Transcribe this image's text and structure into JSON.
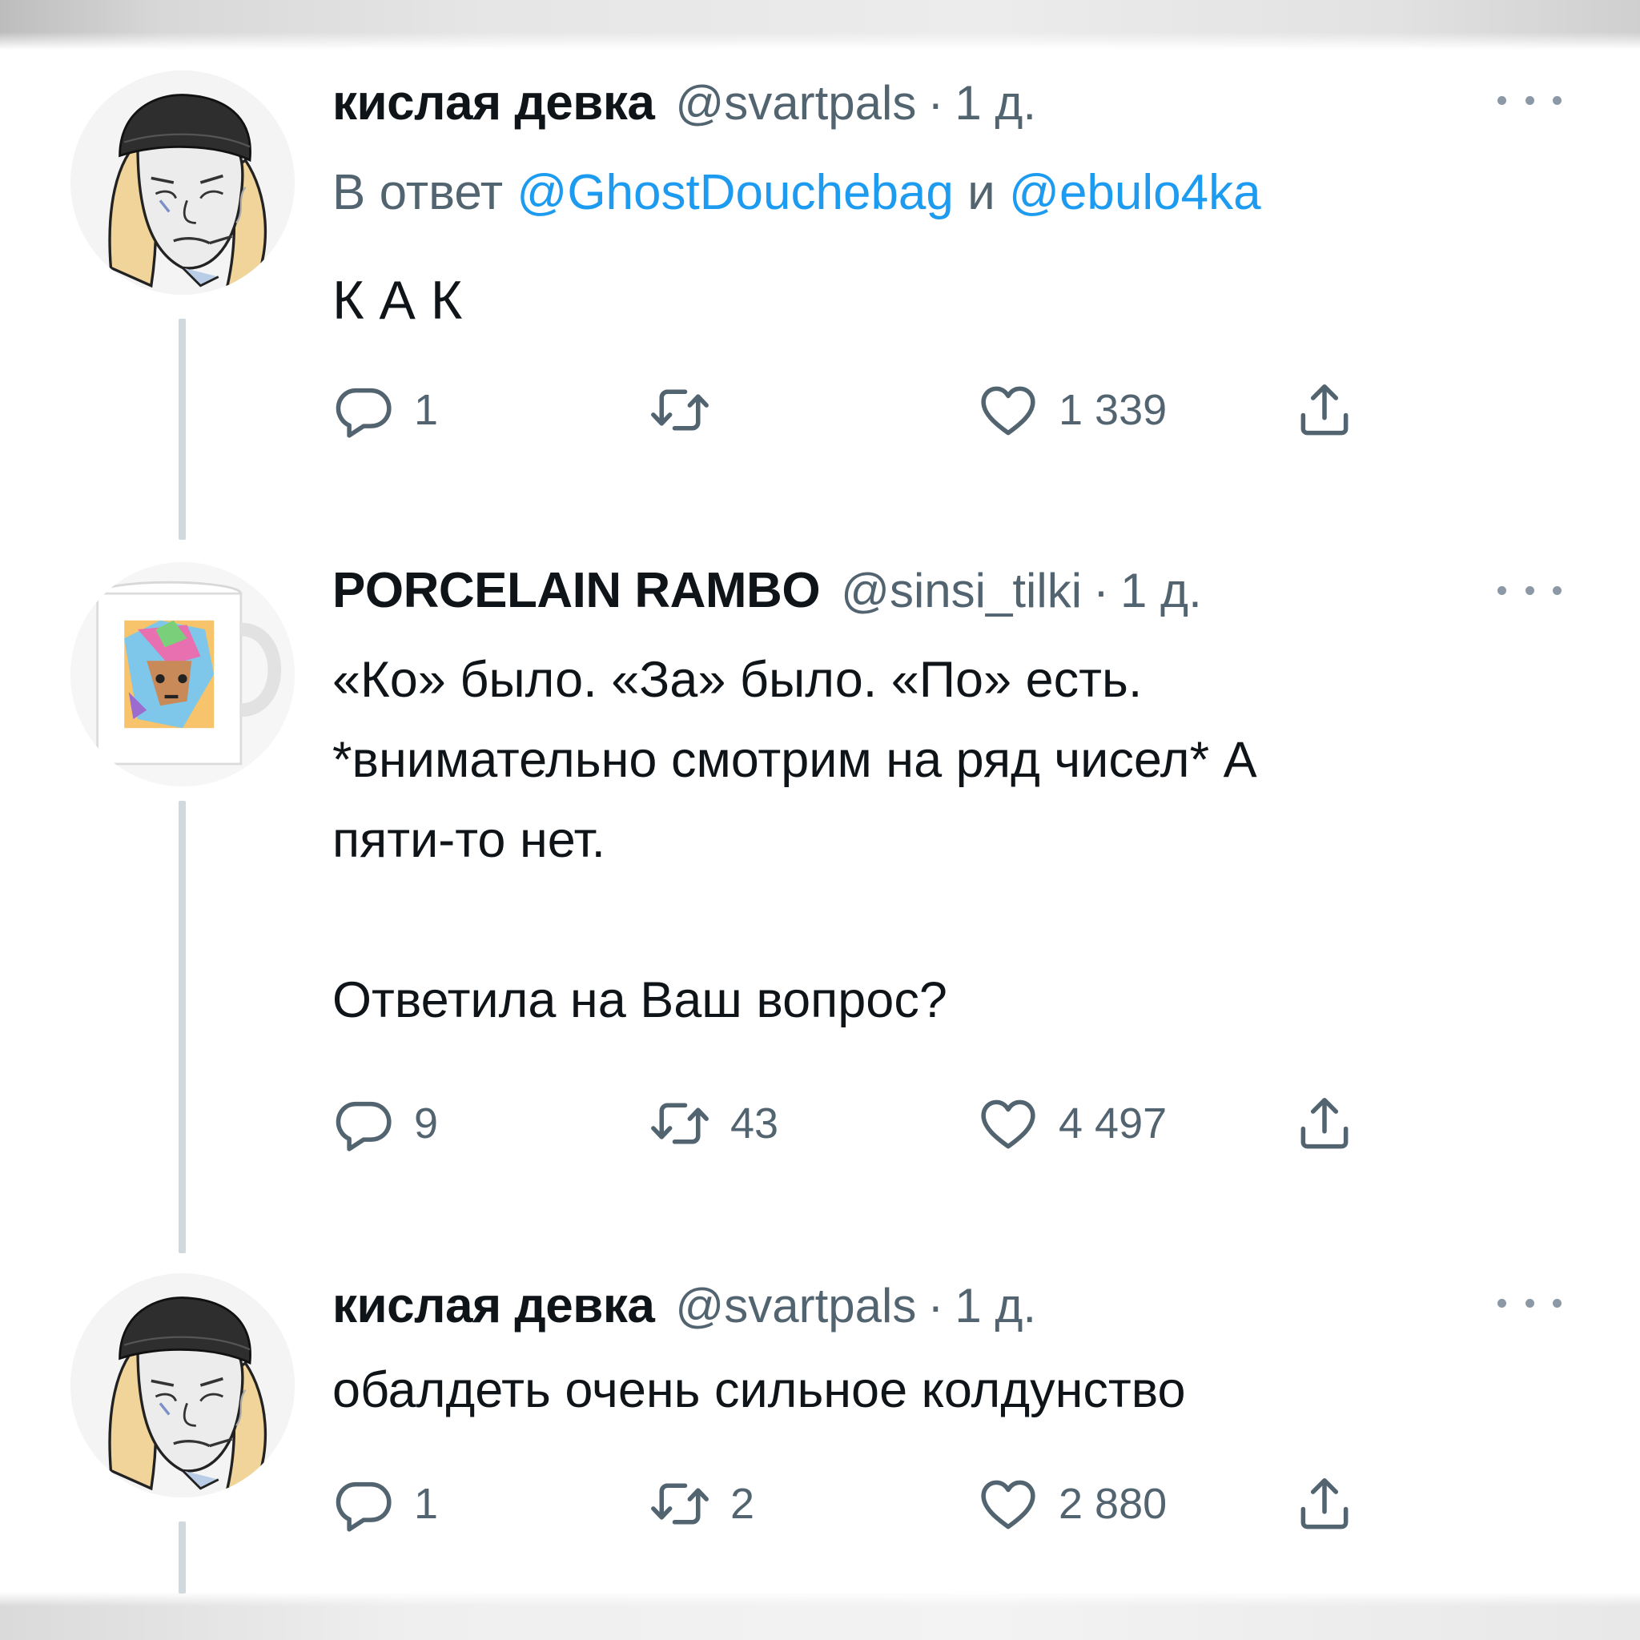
{
  "tweets": [
    {
      "author": "кислая девка",
      "handle": "@svartpals",
      "separator": "·",
      "time": "1 д.",
      "reply_prefix": "В ответ",
      "reply_mention_1": "@GhostDouchebag",
      "reply_conjunction": "и",
      "reply_mention_2": "@ebulo4ka",
      "text": "К А К",
      "replies": "1",
      "retweets": "",
      "likes": "1 339"
    },
    {
      "author": "PORCELAIN RAMBO",
      "handle": "@sinsi_tilki",
      "separator": "·",
      "time": "1 д.",
      "text": "«Ко» было. «За» было. «По» есть.\n*внимательно смотрим на ряд чисел* А\nпяти-то нет.\n\nОтветила на Ваш вопрос?",
      "replies": "9",
      "retweets": "43",
      "likes": "4 497"
    },
    {
      "author": "кислая девка",
      "handle": "@svartpals",
      "separator": "·",
      "time": "1 д.",
      "text": "обалдеть очень сильное колдунство",
      "replies": "1",
      "retweets": "2",
      "likes": "2 880"
    }
  ],
  "icons": {
    "reply": "reply-icon",
    "retweet": "retweet-icon",
    "like": "heart-icon",
    "share": "share-icon",
    "more": "more-icon"
  },
  "colors": {
    "text": "#0f1419",
    "secondary": "#536471",
    "link": "#1d9bf0",
    "thread_line": "#cfd9de"
  }
}
